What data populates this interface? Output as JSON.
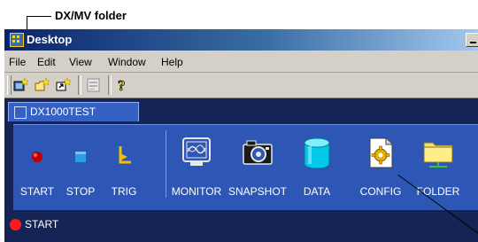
{
  "callout": {
    "label": "DX/MV folder"
  },
  "window": {
    "title": "Desktop"
  },
  "menu": [
    "File",
    "Edit",
    "View",
    "Window",
    "Help"
  ],
  "toolbar_icons": [
    "new-folder-icon",
    "new-item-icon",
    "open-icon",
    "properties-icon",
    "help-icon"
  ],
  "tab": {
    "label": "DX1000TEST"
  },
  "tools": [
    {
      "label": "START",
      "icon": "start-icon"
    },
    {
      "label": "STOP",
      "icon": "stop-icon"
    },
    {
      "label": "TRIG",
      "icon": "trigger-icon"
    },
    {
      "label": "MONITOR",
      "icon": "monitor-icon"
    },
    {
      "label": "SNAPSHOT",
      "icon": "camera-icon"
    },
    {
      "label": "DATA",
      "icon": "data-cylinder-icon"
    },
    {
      "label": "CONFIG",
      "icon": "config-gear-icon"
    },
    {
      "label": "FOLDER",
      "icon": "folder-icon"
    }
  ],
  "status": {
    "text": "START",
    "dot_color": "#ff1a1a"
  },
  "colors": {
    "panel": "#2e56b5",
    "workspace": "#152455",
    "tab": "#3560c4"
  }
}
